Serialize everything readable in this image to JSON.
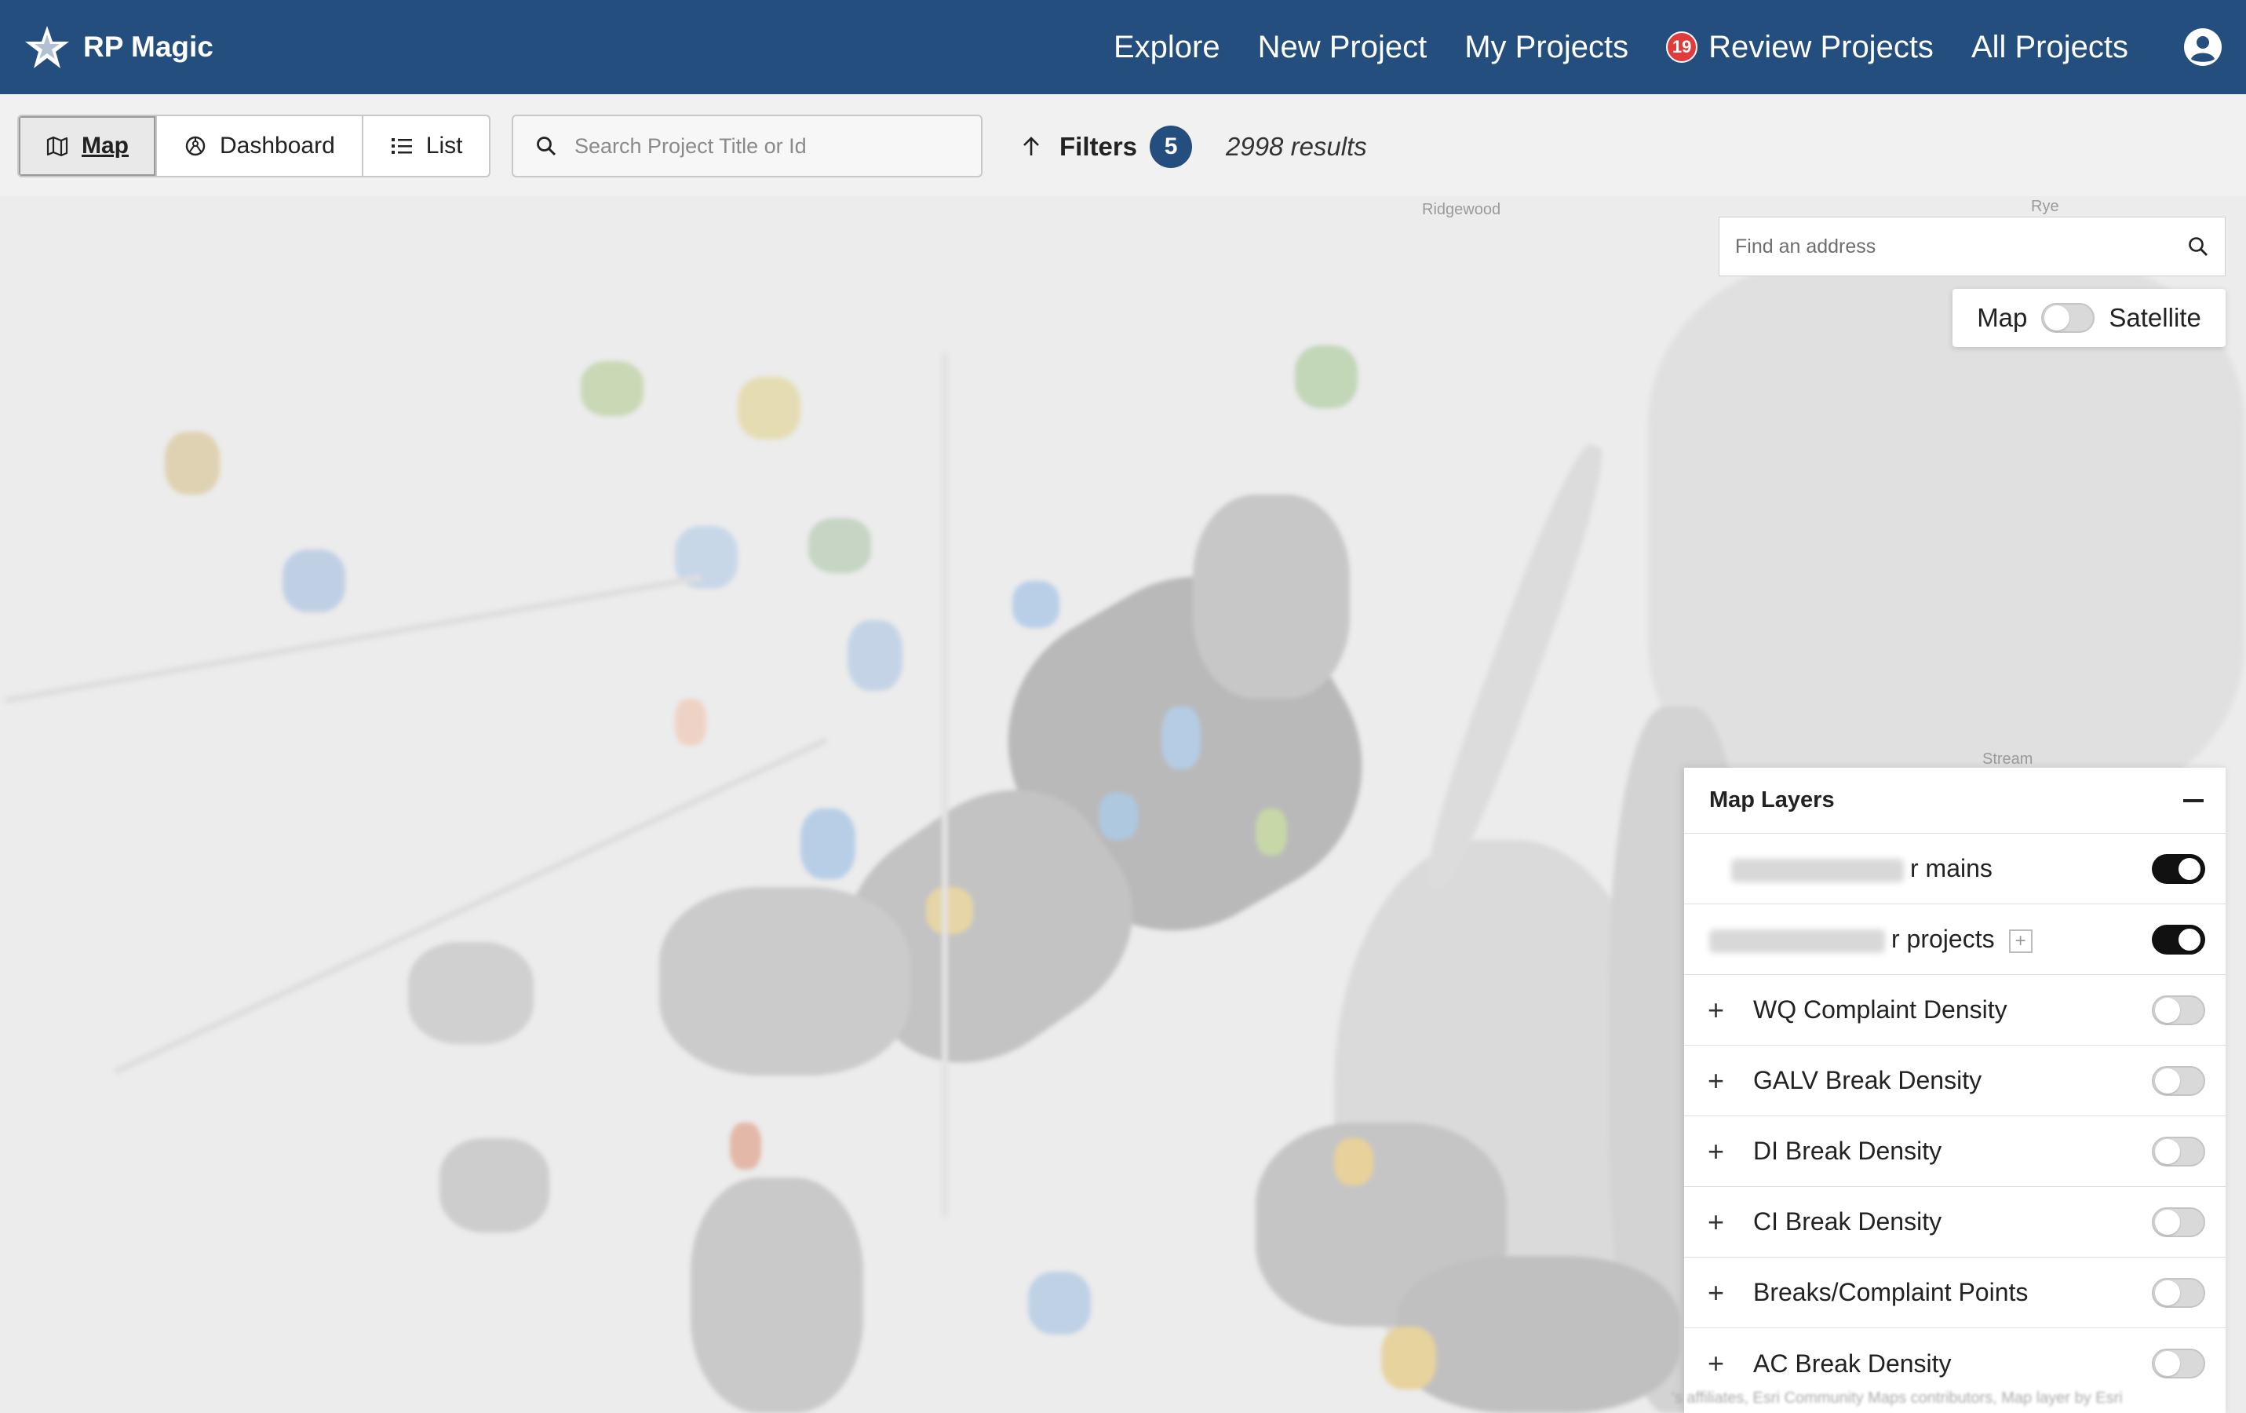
{
  "navbar": {
    "brand_name": "RP Magic",
    "links": [
      {
        "label": "Explore"
      },
      {
        "label": "New Project"
      },
      {
        "label": "My Projects"
      },
      {
        "label": "Review Projects",
        "badge": "19"
      },
      {
        "label": "All Projects"
      }
    ],
    "icons": {
      "brand": "star-logo-icon",
      "user": "user-circle-icon"
    }
  },
  "toolbar": {
    "views": [
      {
        "label": "Map",
        "icon": "map-icon",
        "active": true
      },
      {
        "label": "Dashboard",
        "icon": "dashboard-icon",
        "active": false
      },
      {
        "label": "List",
        "icon": "list-icon",
        "active": false
      }
    ],
    "search_placeholder": "Search Project Title or Id",
    "filters_label": "Filters",
    "filters_count": "5",
    "results_text": "2998 results"
  },
  "map": {
    "place_labels": [
      "Ridgewood",
      "Rye",
      "Stream"
    ],
    "address_placeholder": "Find an address",
    "basemap": {
      "left_label": "Map",
      "right_label": "Satellite",
      "satellite_on": false
    },
    "attribution": "'s affiliates, Esri Community Maps contributors, Map layer by Esri"
  },
  "layers_panel": {
    "title": "Map Layers",
    "layers": [
      {
        "label": "r mains",
        "redacted_prefix": true,
        "expandable": false,
        "on": true
      },
      {
        "label": "r projects",
        "redacted_prefix": true,
        "expandable": false,
        "on": true,
        "has_add_icon": true
      },
      {
        "label": "WQ Complaint Density",
        "expandable": true,
        "on": false
      },
      {
        "label": "GALV Break Density",
        "expandable": true,
        "on": false
      },
      {
        "label": "DI Break Density",
        "expandable": true,
        "on": false
      },
      {
        "label": "CI Break Density",
        "expandable": true,
        "on": false
      },
      {
        "label": "Breaks/Complaint Points",
        "expandable": true,
        "on": false
      },
      {
        "label": "AC Break Density",
        "expandable": true,
        "on": false
      }
    ]
  },
  "colors": {
    "navbar_bg": "#234e7e",
    "badge_red": "#e23b3b",
    "filter_badge": "#234e7e",
    "toggle_on": "#111111",
    "toggle_off": "#d9d9d9"
  }
}
